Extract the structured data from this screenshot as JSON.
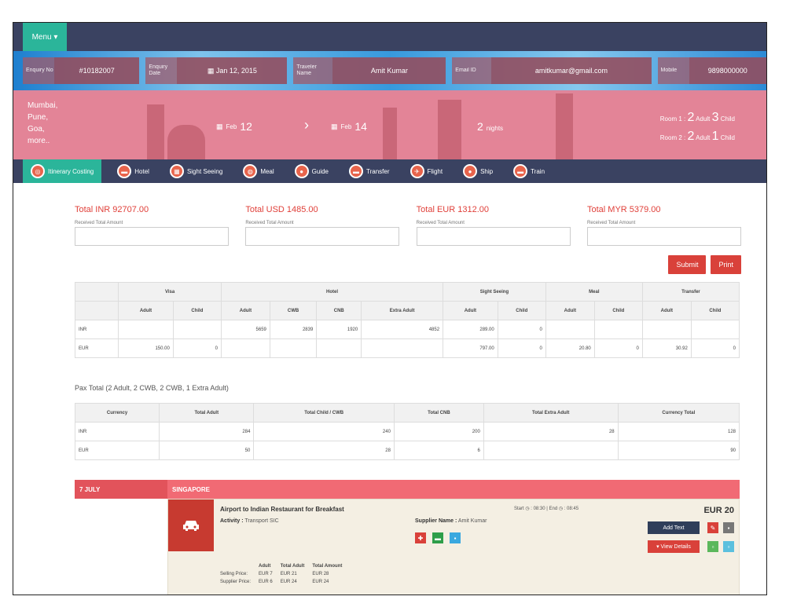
{
  "topbar": {
    "menu_label": "Menu ▾"
  },
  "enquiry": {
    "fields": [
      {
        "label": "Enquiry No",
        "value": "#10182007"
      },
      {
        "label": "Enquiry Date",
        "value": "Jan 12, 2015"
      },
      {
        "label": "Traveler Name",
        "value": "Amit Kumar"
      },
      {
        "label": "Email ID",
        "value": "amitkumar@gmail.com"
      },
      {
        "label": "Mobile",
        "value": "9898000000"
      }
    ]
  },
  "trip": {
    "cities": [
      "Mumbai,",
      "Pune,",
      "Goa,",
      "more.."
    ],
    "from_day": "12",
    "from_month": "Feb",
    "to_day": "14",
    "to_month": "Feb",
    "nights_num": "2",
    "nights_label": "nights",
    "rooms": [
      {
        "label": "Room 1 :",
        "adult": "2",
        "adult_lbl": "Adult",
        "child": "3",
        "child_lbl": "Child"
      },
      {
        "label": "Room 2 :",
        "adult": "2",
        "adult_lbl": "Adult",
        "child": "1",
        "child_lbl": "Child"
      }
    ]
  },
  "tabs": [
    {
      "label": "Itinerary Costing",
      "icon": "◎"
    },
    {
      "label": "Hotel",
      "icon": "▬"
    },
    {
      "label": "Sight Seeing",
      "icon": "▦"
    },
    {
      "label": "Meal",
      "icon": "◍"
    },
    {
      "label": "Guide",
      "icon": "●"
    },
    {
      "label": "Transfer",
      "icon": "▬"
    },
    {
      "label": "Flight",
      "icon": "✈"
    },
    {
      "label": "Ship",
      "icon": "●"
    },
    {
      "label": "Train",
      "icon": "▬"
    }
  ],
  "totals": [
    {
      "title": "Total INR 92707.00",
      "label": "Received Total Amount"
    },
    {
      "title": "Total USD 1485.00",
      "label": "Received Total Amount"
    },
    {
      "title": "Total EUR 1312.00",
      "label": "Received Total Amount"
    },
    {
      "title": "Total MYR 5379.00",
      "label": "Received Total Amount"
    }
  ],
  "buttons": {
    "submit": "Submit",
    "print": "Print"
  },
  "cost_table": {
    "groups": [
      "Visa",
      "Hotel",
      "Sight Seeing",
      "Meal",
      "Transfer"
    ],
    "subheaders": [
      "Adult",
      "Child",
      "Adult",
      "CWB",
      "CNB",
      "Extra Adult",
      "Adult",
      "Child",
      "Adult",
      "Child",
      "Adult",
      "Child"
    ],
    "rows": [
      [
        "INR",
        "",
        "",
        "5659",
        "2839",
        "1920",
        "4852",
        "289.00",
        "0",
        "",
        "",
        "",
        ""
      ],
      [
        "EUR",
        "150.00",
        "0",
        "",
        "",
        "",
        "",
        "797.00",
        "0",
        "20.80",
        "0",
        "30.92",
        "0"
      ]
    ]
  },
  "pax_total": {
    "title": "Pax Total (2 Adult, 2 CWB, 2 CWB, 1 Extra Adult)",
    "headers": [
      "Currency",
      "Total Adult",
      "Total Child / CWB",
      "Total CNB",
      "Total Extra Adult",
      "Currency Total"
    ],
    "rows": [
      [
        "INR",
        "284",
        "240",
        "200",
        "28",
        "128"
      ],
      [
        "EUR",
        "50",
        "28",
        "6",
        "",
        "90"
      ]
    ]
  },
  "day": {
    "date": "7 JULY",
    "city": "SINGAPORE",
    "activity": {
      "title": "Airport to Indian Restaurant for Breakfast",
      "activity_label": "Activity :",
      "activity_value": "Transport SIC",
      "time": "Start ◷ : 08:30 | End ◷ : 08:45",
      "price": "EUR 20",
      "supplier_label": "Supplier Name :",
      "supplier_value": "Amit Kumar",
      "add_text": "Add Text",
      "view_details": "▾ View Details",
      "price_headers": [
        "",
        "Adult",
        "Total Adult",
        "Total Amount"
      ],
      "price_rows": [
        [
          "Selling Price:",
          "EUR 7",
          "EUR 21",
          "EUR 28"
        ],
        [
          "Supplier Price:",
          "EUR 6",
          "EUR 24",
          "EUR 24"
        ]
      ]
    }
  },
  "colors": {
    "navy": "#3a4261",
    "teal": "#2bb59a",
    "red": "#d9413a",
    "pink": "#f16a74"
  }
}
